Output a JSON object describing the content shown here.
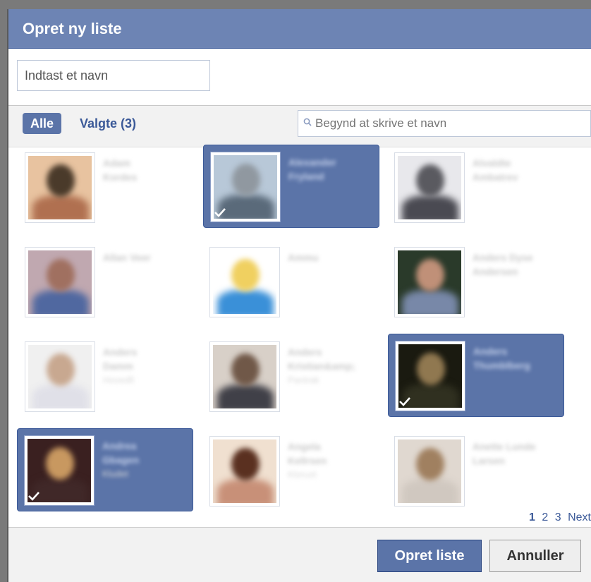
{
  "dialog": {
    "title": "Opret ny liste",
    "name_input": {
      "value": "Indtast et navn",
      "placeholder": "Indtast et navn"
    },
    "tabs": {
      "all_label": "Alle",
      "selected_label": "Valgte (3)"
    },
    "search": {
      "placeholder": "Begynd at skrive et navn",
      "icon": "search-icon"
    },
    "friends": [
      {
        "line1": "Adam",
        "line2": "Kordes",
        "line3": "",
        "selected": false
      },
      {
        "line1": "Alexander",
        "line2": "Fryland",
        "line3": "",
        "selected": true
      },
      {
        "line1": "Alvaldte",
        "line2": "Ambatrev",
        "line3": "",
        "selected": false
      },
      {
        "line1": "Allan Veer",
        "line2": "",
        "line3": "",
        "selected": false
      },
      {
        "line1": "Ammu",
        "line2": "",
        "line3": "",
        "selected": false
      },
      {
        "line1": "Anders Dyse",
        "line2": "Andersen",
        "line3": "",
        "selected": false
      },
      {
        "line1": "Anders",
        "line2": "Damm",
        "line3": "Hovedfi",
        "selected": false
      },
      {
        "line1": "Anders",
        "line2": "Kristian&amp;",
        "line3": "Pantrak",
        "selected": false
      },
      {
        "line1": "Anders",
        "line2": "Thumblberg",
        "line3": "",
        "selected": true
      },
      {
        "line1": "Andrea",
        "line2": "Gbagen",
        "line3": "Kludet",
        "selected": true
      },
      {
        "line1": "Angela",
        "line2": "Kellrsen",
        "line3": "Kloruvt",
        "selected": false
      },
      {
        "line1": "Anette Lunde",
        "line2": "Larsen",
        "line3": "",
        "selected": false
      }
    ],
    "pagination": {
      "current": "1",
      "pages": [
        "2",
        "3"
      ],
      "next": "Next"
    },
    "buttons": {
      "create": "Opret liste",
      "cancel": "Annuller"
    },
    "colors": {
      "header": "#6d84b4",
      "selected_card": "#5b74a8",
      "link": "#3b5998"
    }
  }
}
